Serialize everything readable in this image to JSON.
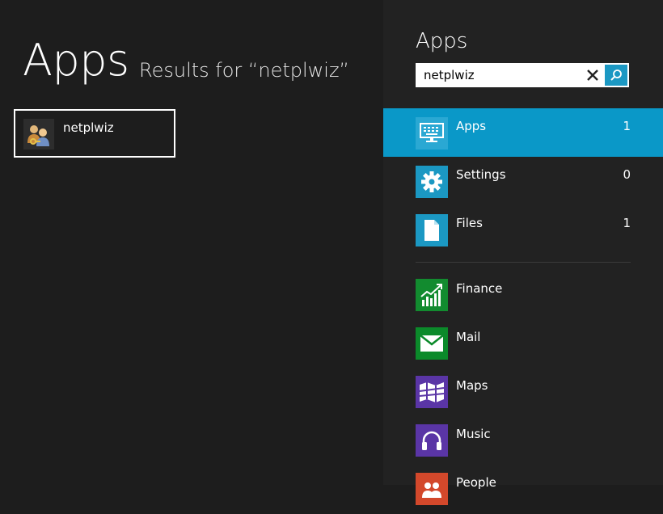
{
  "main": {
    "title": "Apps",
    "results_caption": "Results for “netplwiz”",
    "results": [
      {
        "label": "netplwiz",
        "icon": "user-accounts-icon"
      }
    ]
  },
  "search_pane": {
    "title": "Apps",
    "search_value": "netplwiz",
    "scopes": [
      {
        "label": "Apps",
        "count": "1",
        "icon": "keyboard-monitor-icon",
        "selected": true,
        "color": "#0a98c8"
      },
      {
        "label": "Settings",
        "count": "0",
        "icon": "gear-icon",
        "color": "#1b98c3"
      },
      {
        "label": "Files",
        "count": "1",
        "icon": "file-icon",
        "color": "#1b98c3"
      }
    ],
    "apps": [
      {
        "label": "Finance",
        "icon": "finance-chart-icon",
        "color": "#128b2f"
      },
      {
        "label": "Mail",
        "icon": "mail-icon",
        "color": "#0b8a2a"
      },
      {
        "label": "Maps",
        "icon": "maps-icon",
        "color": "#5a35a6"
      },
      {
        "label": "Music",
        "icon": "headphones-icon",
        "color": "#5a35a6"
      },
      {
        "label": "People",
        "icon": "people-icon",
        "color": "#d3482b"
      }
    ]
  }
}
